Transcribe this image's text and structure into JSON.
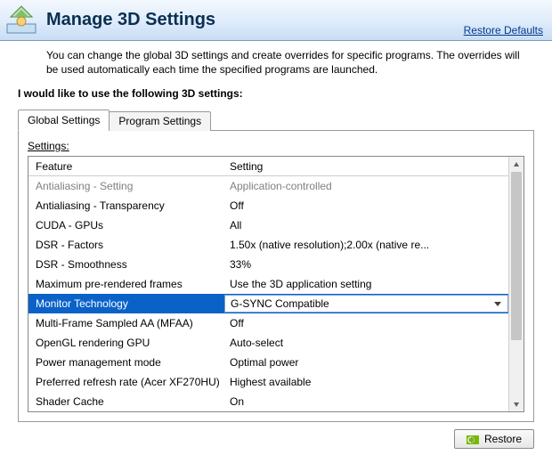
{
  "header": {
    "title": "Manage 3D Settings",
    "restore_defaults": "Restore Defaults"
  },
  "intro": "You can change the global 3D settings and create overrides for specific programs. The overrides will be used automatically each time the specified programs are launched.",
  "section_label": "I would like to use the following 3D settings:",
  "tabs": {
    "global": "Global Settings",
    "program": "Program Settings"
  },
  "grid": {
    "caption": "Settings:",
    "col_feature": "Feature",
    "col_setting": "Setting",
    "rows": [
      {
        "feature": "Antialiasing - Setting",
        "setting": "Application-controlled",
        "disabled": true
      },
      {
        "feature": "Antialiasing - Transparency",
        "setting": "Off"
      },
      {
        "feature": "CUDA - GPUs",
        "setting": "All"
      },
      {
        "feature": "DSR - Factors",
        "setting": "1.50x (native resolution);2.00x (native re..."
      },
      {
        "feature": "DSR - Smoothness",
        "setting": "33%"
      },
      {
        "feature": "Maximum pre-rendered frames",
        "setting": "Use the 3D application setting"
      },
      {
        "feature": "Monitor Technology",
        "setting": "G-SYNC Compatible",
        "selected": true
      },
      {
        "feature": "Multi-Frame Sampled AA (MFAA)",
        "setting": "Off"
      },
      {
        "feature": "OpenGL rendering GPU",
        "setting": "Auto-select"
      },
      {
        "feature": "Power management mode",
        "setting": "Optimal power"
      },
      {
        "feature": "Preferred refresh rate (Acer XF270HU)",
        "setting": "Highest available"
      },
      {
        "feature": "Shader Cache",
        "setting": "On"
      }
    ]
  },
  "footer": {
    "restore": "Restore"
  }
}
